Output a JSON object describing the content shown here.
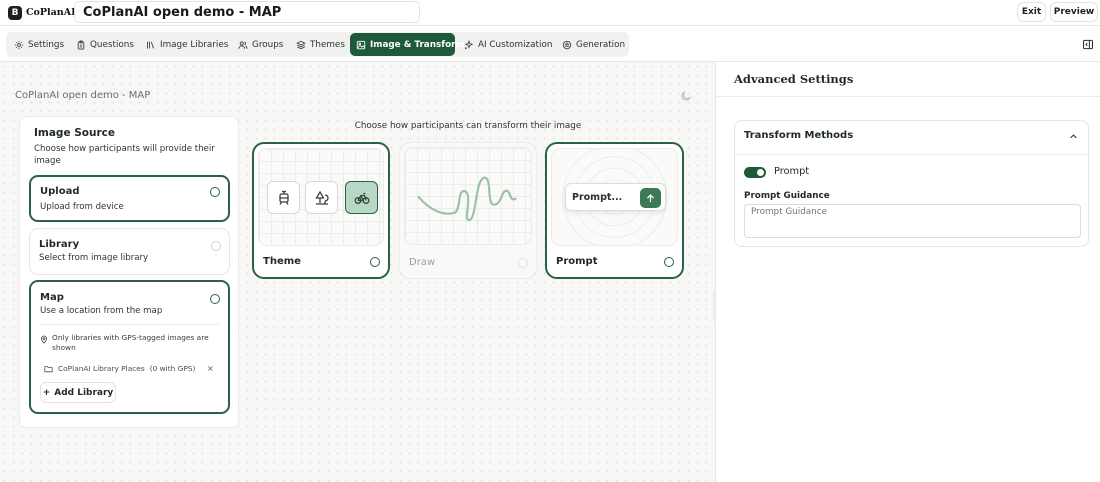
{
  "app": {
    "logo_mark": "B",
    "logo_text": "CoPlanAI",
    "project_title": "CoPlanAI open demo - MAP",
    "exit_label": "Exit",
    "preview_label": "Preview"
  },
  "tabs": [
    {
      "label": "Settings",
      "icon": "gear-icon"
    },
    {
      "label": "Questions",
      "icon": "clipboard-icon"
    },
    {
      "label": "Image Libraries",
      "icon": "library-icon"
    },
    {
      "label": "Groups",
      "icon": "users-icon"
    },
    {
      "label": "Themes",
      "icon": "layers-icon"
    },
    {
      "label": "Image & Transform",
      "icon": "image-icon",
      "active": true
    },
    {
      "label": "AI Customization",
      "icon": "sparkles-icon"
    },
    {
      "label": "Generation",
      "icon": "generation-icon"
    }
  ],
  "canvas": {
    "project_name": "CoPlanAI open demo - MAP"
  },
  "image_source": {
    "title": "Image Source",
    "description": "Choose how participants will provide their image",
    "options": [
      {
        "title": "Upload",
        "description": "Upload from device",
        "selected": true
      },
      {
        "title": "Library",
        "description": "Select from image library",
        "selected": false
      },
      {
        "title": "Map",
        "description": "Use a location from the map",
        "selected": true
      }
    ],
    "map_note": "Only libraries with GPS-tagged images are shown",
    "library_name": "CoPlanAI Library Places",
    "library_gps": "(0 with GPS)",
    "remove_label": "×",
    "add_library_label": "Add Library"
  },
  "transform": {
    "heading": "Choose how participants can transform their image",
    "cards": [
      {
        "label": "Theme",
        "selected": true,
        "disabled": false
      },
      {
        "label": "Draw",
        "selected": false,
        "disabled": true
      },
      {
        "label": "Prompt",
        "selected": true,
        "disabled": false
      }
    ],
    "prompt_preview_text": "Prompt..."
  },
  "advanced": {
    "title": "Advanced Settings",
    "section_title": "Transform Methods",
    "prompt_toggle_label": "Prompt",
    "prompt_enabled": true,
    "guidance_label": "Prompt Guidance",
    "guidance_placeholder": "Prompt Guidance"
  },
  "colors": {
    "accent": "#1e5a3a",
    "accent_light": "#b8d7c4"
  }
}
